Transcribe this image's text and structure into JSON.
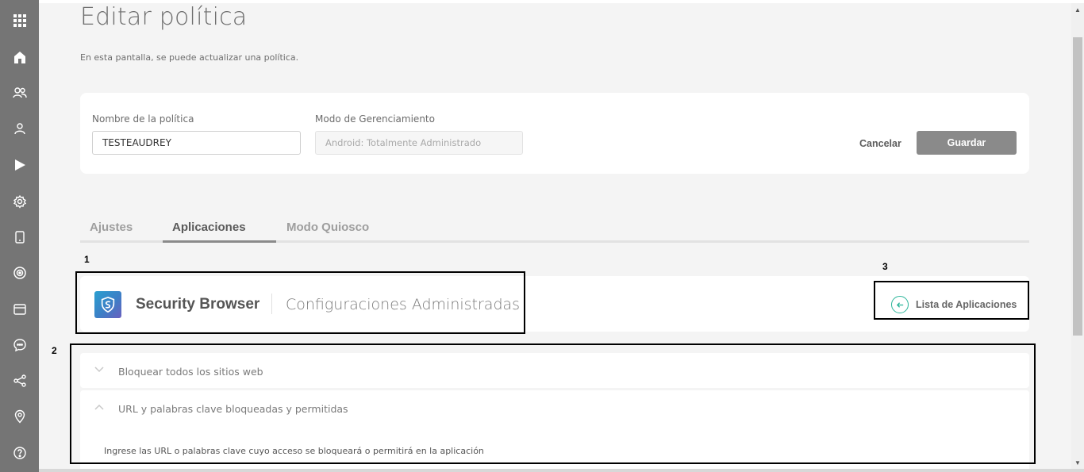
{
  "page": {
    "title": "Editar política",
    "subtitle": "En esta pantalla, se puede actualizar una política."
  },
  "form": {
    "policy_name_label": "Nombre de la política",
    "policy_name_value": "TESTEAUDREY",
    "management_mode_label": "Modo de Gerenciamiento",
    "management_mode_value": "Android: Totalmente Administrado",
    "cancel_label": "Cancelar",
    "save_label": "Guardar"
  },
  "tabs": [
    {
      "label": "Ajustes",
      "active": false
    },
    {
      "label": "Aplicaciones",
      "active": true
    },
    {
      "label": "Modo Quiosco",
      "active": false
    }
  ],
  "markers": {
    "one": "1",
    "two": "2",
    "three": "3"
  },
  "app": {
    "name": "Security Browser",
    "section": "Configuraciones Administradas",
    "list_link": "Lista de Aplicaciones"
  },
  "accordions": [
    {
      "label": "Bloquear todos los sitios web",
      "expanded": false
    },
    {
      "label": "URL y palabras clave bloqueadas y permitidas",
      "expanded": true,
      "body": "Ingrese las URL o palabras clave cuyo acceso se bloqueará o permitirá en la aplicación"
    }
  ],
  "sidebar": {
    "icons": [
      "apps-grid-icon",
      "dashboard-home-icon",
      "users-group-icon",
      "user-icon",
      "play-store-icon",
      "settings-gear-icon",
      "device-icon",
      "target-icon",
      "window-icon",
      "chat-icon",
      "share-icon",
      "location-pin-icon",
      "help-icon"
    ]
  },
  "colors": {
    "sidebar": "#757575",
    "accent_teal": "#2bb59a",
    "save_button": "#8a8a8a",
    "background": "#f4f4f4"
  }
}
